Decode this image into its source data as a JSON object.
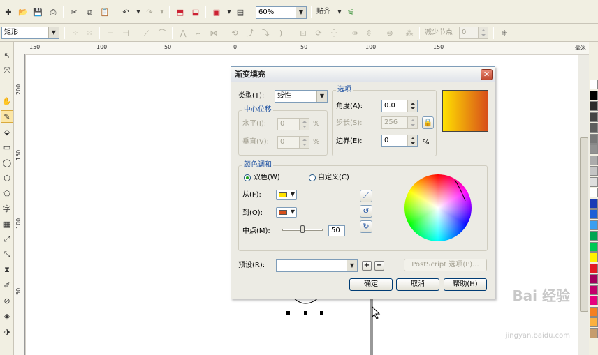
{
  "toolbar": {
    "zoom": "60%",
    "snap_label": "贴齐",
    "object_type": "矩形",
    "reduce_nodes_label": "减少节点",
    "reduce_nodes_value": "0"
  },
  "ruler": {
    "top_labels": [
      "150",
      "100",
      "50",
      "0",
      "50",
      "100",
      "150"
    ],
    "unit_label": "毫米",
    "left_labels": [
      "200",
      "150",
      "100",
      "50"
    ]
  },
  "dialog": {
    "title": "渐变填充",
    "type_label": "类型(T):",
    "type_value": "线性",
    "center_offset_title": "中心位移",
    "horizontal_label": "水平(I):",
    "horizontal_value": "0",
    "vertical_label": "垂直(V):",
    "vertical_value": "0",
    "percent": "%",
    "options_title": "选项",
    "angle_label": "角度(A):",
    "angle_value": "0.0",
    "steps_label": "步长(S):",
    "steps_value": "256",
    "edge_label": "边界(E):",
    "edge_value": "0",
    "blend_title": "颜色调和",
    "two_color_label": "双色(W)",
    "custom_label": "自定义(C)",
    "from_label": "从(F):",
    "to_label": "到(O):",
    "midpoint_label": "中点(M):",
    "midpoint_value": "50",
    "midpoint_fraction": 0.5,
    "presets_label": "预设(R):",
    "presets_value": "",
    "postscript_label": "PostScript 选项(P)...",
    "ok_label": "确定",
    "cancel_label": "取消",
    "help_label": "帮助(H)"
  },
  "colors": {
    "from_color": "#ffe100",
    "to_color": "#d84f1a"
  },
  "palette": [
    "#ffffff",
    "#000000",
    "#2b2b2b",
    "#444444",
    "#5e5e5e",
    "#787878",
    "#919191",
    "#ababab",
    "#c4c4c4",
    "#dedede",
    "#ffffff",
    "#1a3bb5",
    "#1e5fd6",
    "#3a9ef0",
    "#00a651",
    "#00c853",
    "#fff200",
    "#e31b23",
    "#a3005c",
    "#c2006b",
    "#e6007e",
    "#f57f20",
    "#fbb040",
    "#c69c6d"
  ],
  "watermark": {
    "brand": "Bai 经验",
    "url": "jingyan.baidu.com"
  }
}
